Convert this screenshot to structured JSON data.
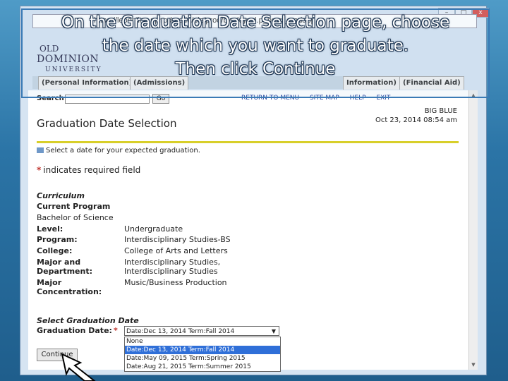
{
  "caption": {
    "line1": "On the Graduation Date Selection page, choose",
    "line2": "the date which you want to graduate.",
    "line3": "Then click Continue"
  },
  "browser": {
    "url": "https://leoonline.ppr.odu.edu/pls/prod/bwskgrad.p_proc_gradapp",
    "controls": [
      "–",
      "□",
      "x"
    ]
  },
  "logo": {
    "line1": "OLD",
    "line2": "DOMINION",
    "line3": "UNIVERSITY"
  },
  "tabs": [
    "(Personal Information)",
    "(Admissions)",
    "Information)",
    "(Financial Aid)"
  ],
  "header": {
    "search_label": "Search",
    "go_label": "Go",
    "links": [
      "RETURN TO MENU",
      "SITE MAP",
      "HELP",
      "EXIT"
    ],
    "user": "BIG BLUE",
    "datetime": "Oct 23, 2014 08:54 am"
  },
  "page": {
    "title": "Graduation Date Selection",
    "instruction": "Select a date for your expected graduation.",
    "required_note": "indicates required field",
    "required_star": "*"
  },
  "curriculum": {
    "heading": "Curriculum",
    "current_program_label": "Current Program",
    "current_program_value": "Bachelor of Science",
    "rows": [
      {
        "label": "Level:",
        "value": "Undergraduate"
      },
      {
        "label": "Program:",
        "value": "Interdisciplinary Studies-BS"
      },
      {
        "label": "College:",
        "value": "College of Arts and Letters"
      },
      {
        "label": "Major and",
        "value": "Interdisciplinary Studies,"
      },
      {
        "label": "Department:",
        "value": "Interdisciplinary Studies"
      },
      {
        "label": "Major",
        "value": "Music/Business Production"
      },
      {
        "label": "Concentration:",
        "value": ""
      }
    ]
  },
  "graduation": {
    "heading": "Select Graduation Date",
    "label": "Graduation Date:",
    "star": "*",
    "selected": "Date:Dec 13, 2014 Term:Fall 2014",
    "options": [
      "None",
      "Date:Dec 13, 2014 Term:Fall 2014",
      "Date:May 09, 2015 Term:Spring 2015",
      "Date:Aug 21, 2015 Term:Summer 2015"
    ],
    "highlighted_index": 1
  },
  "continue_label": "Continue",
  "colors": {
    "accent_yellow": "#d8cf2a",
    "selection_blue": "#2f6fd8",
    "required_red": "#c0332d"
  }
}
